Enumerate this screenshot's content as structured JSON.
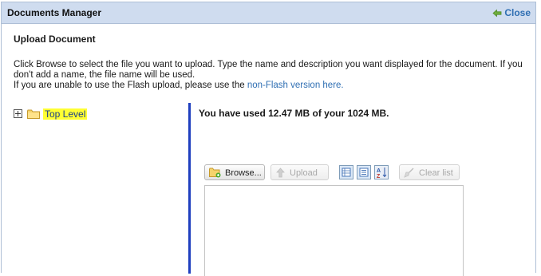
{
  "window": {
    "title": "Documents Manager",
    "close_label": "Close"
  },
  "section": {
    "title": "Upload Document"
  },
  "instructions": {
    "line1": "Click Browse to select the file you want to upload. Type the name and description you want displayed for the document. If you don't add a name, the file name will be used.",
    "line2_prefix": "If you are unable to use the Flash upload, please use the ",
    "line2_link": "non-Flash version here."
  },
  "tree": {
    "root_label": "Top Level"
  },
  "usage": {
    "text": "You have used 12.47 MB of your 1024 MB."
  },
  "toolbar": {
    "browse_label": "Browse...",
    "upload_label": "Upload",
    "clear_label": "Clear list"
  },
  "colors": {
    "titlebar": "#cfdcef",
    "link": "#2f6fb3",
    "divider": "#1f3fbf",
    "highlight": "#ffff33"
  }
}
